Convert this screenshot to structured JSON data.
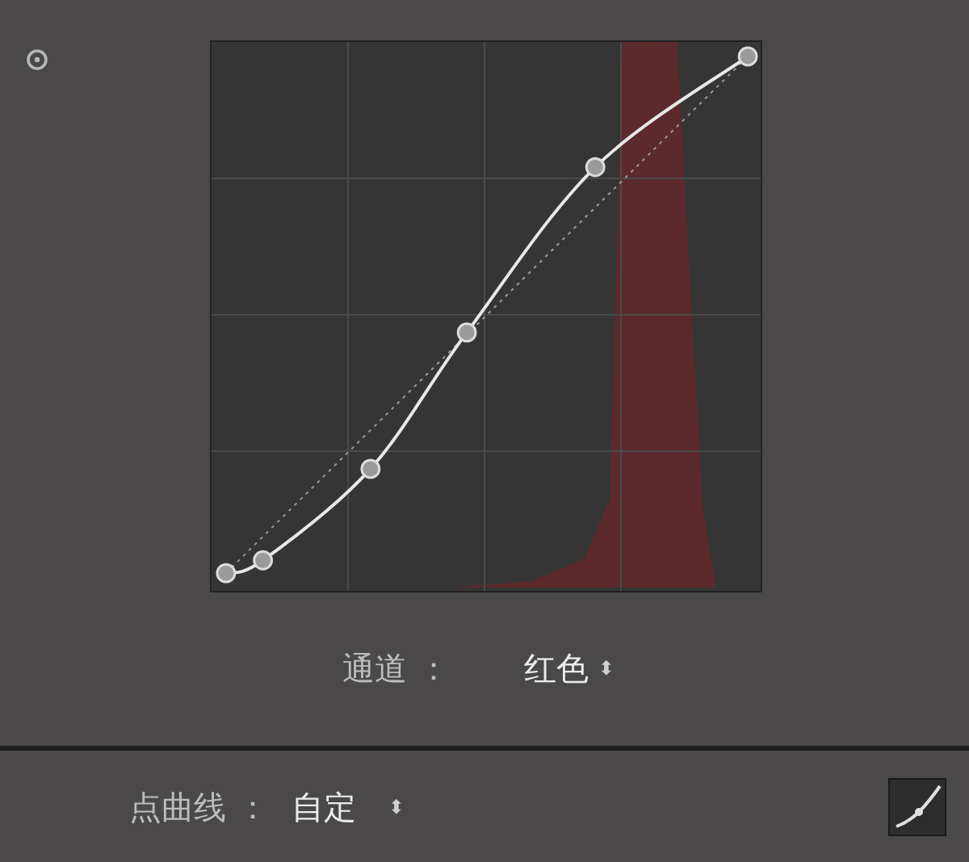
{
  "channel": {
    "label": "通道 ：",
    "value": "红色",
    "arrows": "⬍"
  },
  "point_curve": {
    "label": "点曲线 ：",
    "value": "自定",
    "arrows": "⬍"
  }
}
